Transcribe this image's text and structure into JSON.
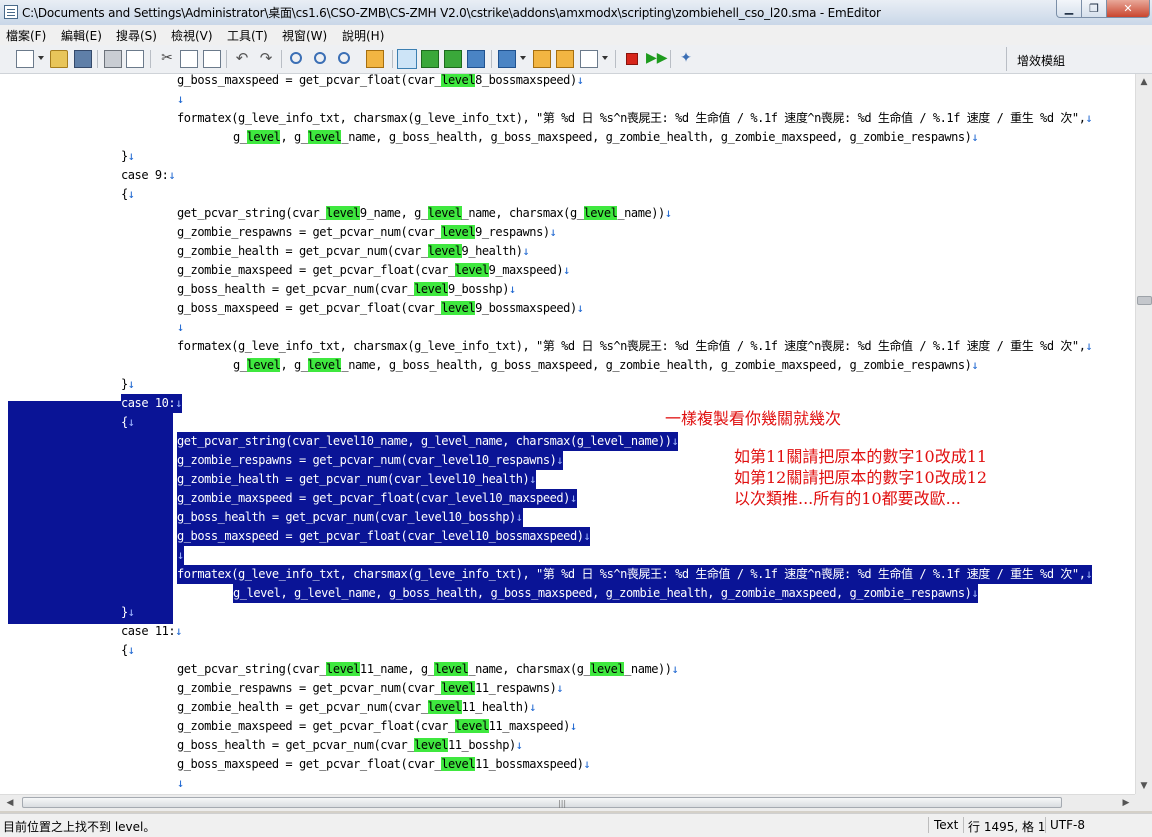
{
  "window": {
    "title": "C:\\Documents and Settings\\Administrator\\桌面\\cs1.6\\CSO-ZMB\\CS-ZMH V2.0\\cstrike\\addons\\amxmodx\\scripting\\zombiehell_cso_l20.sma - EmEditor"
  },
  "menu": [
    {
      "label": "檔案(F)"
    },
    {
      "label": "編輯(E)"
    },
    {
      "label": "搜尋(S)"
    },
    {
      "label": "檢視(V)"
    },
    {
      "label": "工具(T)"
    },
    {
      "label": "視窗(W)"
    },
    {
      "label": "說明(H)"
    }
  ],
  "plugins_panel": {
    "label": "增效模組"
  },
  "editor": {
    "highlight_term": "level",
    "lines": [
      {
        "indent": 2,
        "text": "g_boss_maxspeed = get_pcvar_float(cvar_level8_bossmaxspeed)"
      },
      {
        "indent": 2,
        "text": ""
      },
      {
        "indent": 2,
        "text": "formatex(g_leve_info_txt, charsmax(g_leve_info_txt), \"第 %d 日 %s^n喪屍王: %d 生命值 / %.1f 速度^n喪屍: %d 生命值 / %.1f 速度 / 重生 %d 次\","
      },
      {
        "indent": 3,
        "text": "g_level, g_level_name, g_boss_health, g_boss_maxspeed, g_zombie_health, g_zombie_maxspeed, g_zombie_respawns)"
      },
      {
        "indent": 1,
        "text": "}"
      },
      {
        "indent": 1,
        "text": "case 9:"
      },
      {
        "indent": 1,
        "text": "{"
      },
      {
        "indent": 2,
        "text": "get_pcvar_string(cvar_level9_name, g_level_name, charsmax(g_level_name))"
      },
      {
        "indent": 2,
        "text": "g_zombie_respawns = get_pcvar_num(cvar_level9_respawns)"
      },
      {
        "indent": 2,
        "text": "g_zombie_health = get_pcvar_num(cvar_level9_health)"
      },
      {
        "indent": 2,
        "text": "g_zombie_maxspeed = get_pcvar_float(cvar_level9_maxspeed)"
      },
      {
        "indent": 2,
        "text": "g_boss_health = get_pcvar_num(cvar_level9_bosshp)"
      },
      {
        "indent": 2,
        "text": "g_boss_maxspeed = get_pcvar_float(cvar_level9_bossmaxspeed)"
      },
      {
        "indent": 2,
        "text": ""
      },
      {
        "indent": 2,
        "text": "formatex(g_leve_info_txt, charsmax(g_leve_info_txt), \"第 %d 日 %s^n喪屍王: %d 生命值 / %.1f 速度^n喪屍: %d 生命值 / %.1f 速度 / 重生 %d 次\","
      },
      {
        "indent": 3,
        "text": "g_level, g_level_name, g_boss_health, g_boss_maxspeed, g_zombie_health, g_zombie_maxspeed, g_zombie_respawns)"
      },
      {
        "indent": 1,
        "text": "}"
      },
      {
        "indent": 1,
        "text": "case 10:",
        "selected": true
      },
      {
        "indent": 1,
        "text": "{",
        "selected": true
      },
      {
        "indent": 2,
        "text": "get_pcvar_string(cvar_level10_name, g_level_name, charsmax(g_level_name))",
        "selected": true
      },
      {
        "indent": 2,
        "text": "g_zombie_respawns = get_pcvar_num(cvar_level10_respawns)",
        "selected": true
      },
      {
        "indent": 2,
        "text": "g_zombie_health = get_pcvar_num(cvar_level10_health)",
        "selected": true
      },
      {
        "indent": 2,
        "text": "g_zombie_maxspeed = get_pcvar_float(cvar_level10_maxspeed)",
        "selected": true
      },
      {
        "indent": 2,
        "text": "g_boss_health = get_pcvar_num(cvar_level10_bosshp)",
        "selected": true
      },
      {
        "indent": 2,
        "text": "g_boss_maxspeed = get_pcvar_float(cvar_level10_bossmaxspeed)",
        "selected": true
      },
      {
        "indent": 2,
        "text": "",
        "selected": true
      },
      {
        "indent": 2,
        "text": "formatex(g_leve_info_txt, charsmax(g_leve_info_txt), \"第 %d 日 %s^n喪屍王: %d 生命值 / %.1f 速度^n喪屍: %d 生命值 / %.1f 速度 / 重生 %d 次\",",
        "selected": true
      },
      {
        "indent": 3,
        "text": "g_level, g_level_name, g_boss_health, g_boss_maxspeed, g_zombie_health, g_zombie_maxspeed, g_zombie_respawns)",
        "selected": true
      },
      {
        "indent": 1,
        "text": "}",
        "selected": true
      },
      {
        "indent": 1,
        "text": "case 11:"
      },
      {
        "indent": 1,
        "text": "{"
      },
      {
        "indent": 2,
        "text": "get_pcvar_string(cvar_level11_name, g_level_name, charsmax(g_level_name))"
      },
      {
        "indent": 2,
        "text": "g_zombie_respawns = get_pcvar_num(cvar_level11_respawns)"
      },
      {
        "indent": 2,
        "text": "g_zombie_health = get_pcvar_num(cvar_level11_health)"
      },
      {
        "indent": 2,
        "text": "g_zombie_maxspeed = get_pcvar_float(cvar_level11_maxspeed)"
      },
      {
        "indent": 2,
        "text": "g_boss_health = get_pcvar_num(cvar_level11_bosshp)"
      },
      {
        "indent": 2,
        "text": "g_boss_maxspeed = get_pcvar_float(cvar_level11_bossmaxspeed)"
      },
      {
        "indent": 2,
        "text": ""
      }
    ]
  },
  "annotation": {
    "line1": "一樣複製看你幾關就幾次",
    "line2": "如第11關請把原本的數字10改成11",
    "line3": "如第12關請把原本的數字10改成12",
    "line4": "以次類推...所有的10都要改歐..."
  },
  "status": {
    "message": "目前位置之上找不到 level。",
    "mode": "Text",
    "position": "行 1495, 格 1",
    "encoding": "UTF-8"
  },
  "colors": {
    "selection": "#0a1496",
    "find_highlight": "#3fe83f",
    "annotation": "#e01010",
    "newline_mark": "#1a64d0"
  }
}
